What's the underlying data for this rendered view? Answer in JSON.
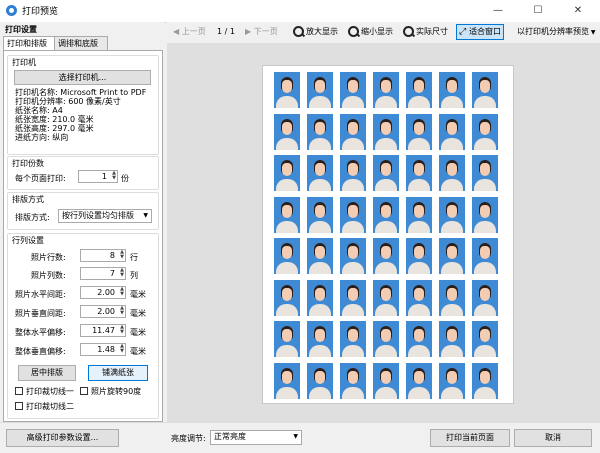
{
  "window": {
    "title": "打印预览",
    "min_glyph": "—",
    "max_glyph": "☐",
    "close_glyph": "✕"
  },
  "left": {
    "header": "打印设置",
    "tabs": [
      "打印和排版",
      "调排和底版"
    ],
    "printer": {
      "group_title": "打印机",
      "select_button": "选择打印机...",
      "info": [
        "打印机名称: Microsoft Print to PDF",
        "打印机分辨率: 600 像素/英寸",
        "纸张名称: A4",
        "纸张宽度: 210.0 毫米",
        "纸张高度: 297.0 毫米",
        "进纸方向: 纵向"
      ]
    },
    "copies": {
      "group_title": "打印份数",
      "label": "每个页面打印:",
      "value": "1",
      "unit": "份"
    },
    "layout": {
      "group_title": "排版方式",
      "label": "排版方式:",
      "value": "按行列设置均匀排版"
    },
    "rowcol": {
      "group_title": "行列设置",
      "fields": [
        {
          "label": "照片行数:",
          "value": "8",
          "unit": "行"
        },
        {
          "label": "照片列数:",
          "value": "7",
          "unit": "列"
        },
        {
          "label": "照片水平间距:",
          "value": "2.00",
          "unit": "毫米"
        },
        {
          "label": "照片垂直间距:",
          "value": "2.00",
          "unit": "毫米"
        },
        {
          "label": "整体水平偏移:",
          "value": "11.47",
          "unit": "毫米"
        },
        {
          "label": "整体垂直偏移:",
          "value": "1.48",
          "unit": "毫米"
        }
      ],
      "center_button": "居中排版",
      "fill_button": "铺满纸张",
      "checkboxes": [
        "打印裁切线一",
        "照片旋转90度",
        "打印裁切线二"
      ]
    },
    "advanced_button": "高级打印参数设置..."
  },
  "toolbar": {
    "prev": "上一页",
    "page": "1 / 1",
    "next": "下一页",
    "zoom_in": "放大显示",
    "zoom_out": "缩小显示",
    "actual": "实际尺寸",
    "fit": "适合窗口",
    "res_preview": "以打印机分辨率预览"
  },
  "grid": {
    "rows": 8,
    "cols": 7
  },
  "bottom": {
    "brightness_label": "亮度调节:",
    "brightness_value": "正常亮度",
    "print_button": "打印当前页面",
    "cancel_button": "取消"
  },
  "colors": {
    "photo_bg": "#3f8ad4",
    "accent": "#0078d7"
  }
}
